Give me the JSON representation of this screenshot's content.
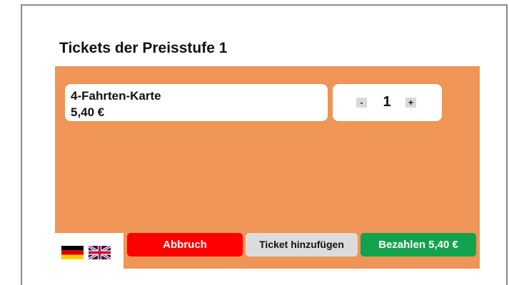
{
  "header": {
    "title": "Tickets der Preisstufe 1"
  },
  "ticket": {
    "name": "4-Fahrten-Karte",
    "price": "5,40 €"
  },
  "quantity": {
    "minus_label": "-",
    "value": "1",
    "plus_label": "+"
  },
  "languages": [
    {
      "code": "de",
      "icon": "german-flag-icon"
    },
    {
      "code": "en",
      "icon": "uk-flag-icon"
    }
  ],
  "actions": {
    "cancel_label": "Abbruch",
    "add_ticket_label": "Ticket hinzufügen",
    "pay_label": "Bezahlen 5,40 €"
  },
  "colors": {
    "panel": "#ee9557",
    "cancel": "#ff0000",
    "add": "#dcdcdc",
    "pay": "#13a24e"
  }
}
